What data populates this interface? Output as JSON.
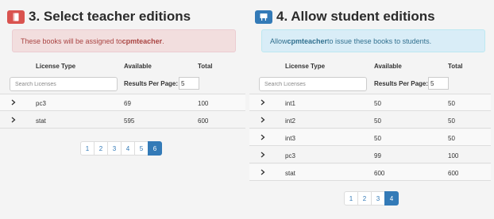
{
  "teacher": {
    "title": "3. Select teacher editions",
    "icon": "book-icon",
    "icon_color": "#d9534f",
    "alert_prefix": "These books will be assigned to ",
    "alert_user": "cpmteacher",
    "alert_suffix": ".",
    "columns": {
      "license_type": "License Type",
      "available": "Available",
      "total": "Total"
    },
    "search_placeholder": "Search Licenses",
    "results_per_page_label": "Results Per Page:",
    "results_per_page_value": "5",
    "rows": [
      {
        "license": "pc3",
        "available": "69",
        "total": "100"
      },
      {
        "license": "stat",
        "available": "595",
        "total": "600"
      }
    ],
    "pages": [
      "1",
      "2",
      "3",
      "4",
      "5",
      "6"
    ],
    "active_page": "6"
  },
  "student": {
    "title": "4. Allow student editions",
    "icon": "desk-icon",
    "icon_color": "#337ab7",
    "alert_prefix": "Allow ",
    "alert_user": "cpmteacher",
    "alert_suffix": " to issue these books to students.",
    "columns": {
      "license_type": "License Type",
      "available": "Available",
      "total": "Total"
    },
    "search_placeholder": "Search Licenses",
    "results_per_page_label": "Results Per Page:",
    "results_per_page_value": "5",
    "rows": [
      {
        "license": "int1",
        "available": "50",
        "total": "50"
      },
      {
        "license": "int2",
        "available": "50",
        "total": "50"
      },
      {
        "license": "int3",
        "available": "50",
        "total": "50"
      },
      {
        "license": "pc3",
        "available": "99",
        "total": "100"
      },
      {
        "license": "stat",
        "available": "600",
        "total": "600"
      }
    ],
    "pages": [
      "1",
      "2",
      "3",
      "4"
    ],
    "active_page": "4"
  }
}
